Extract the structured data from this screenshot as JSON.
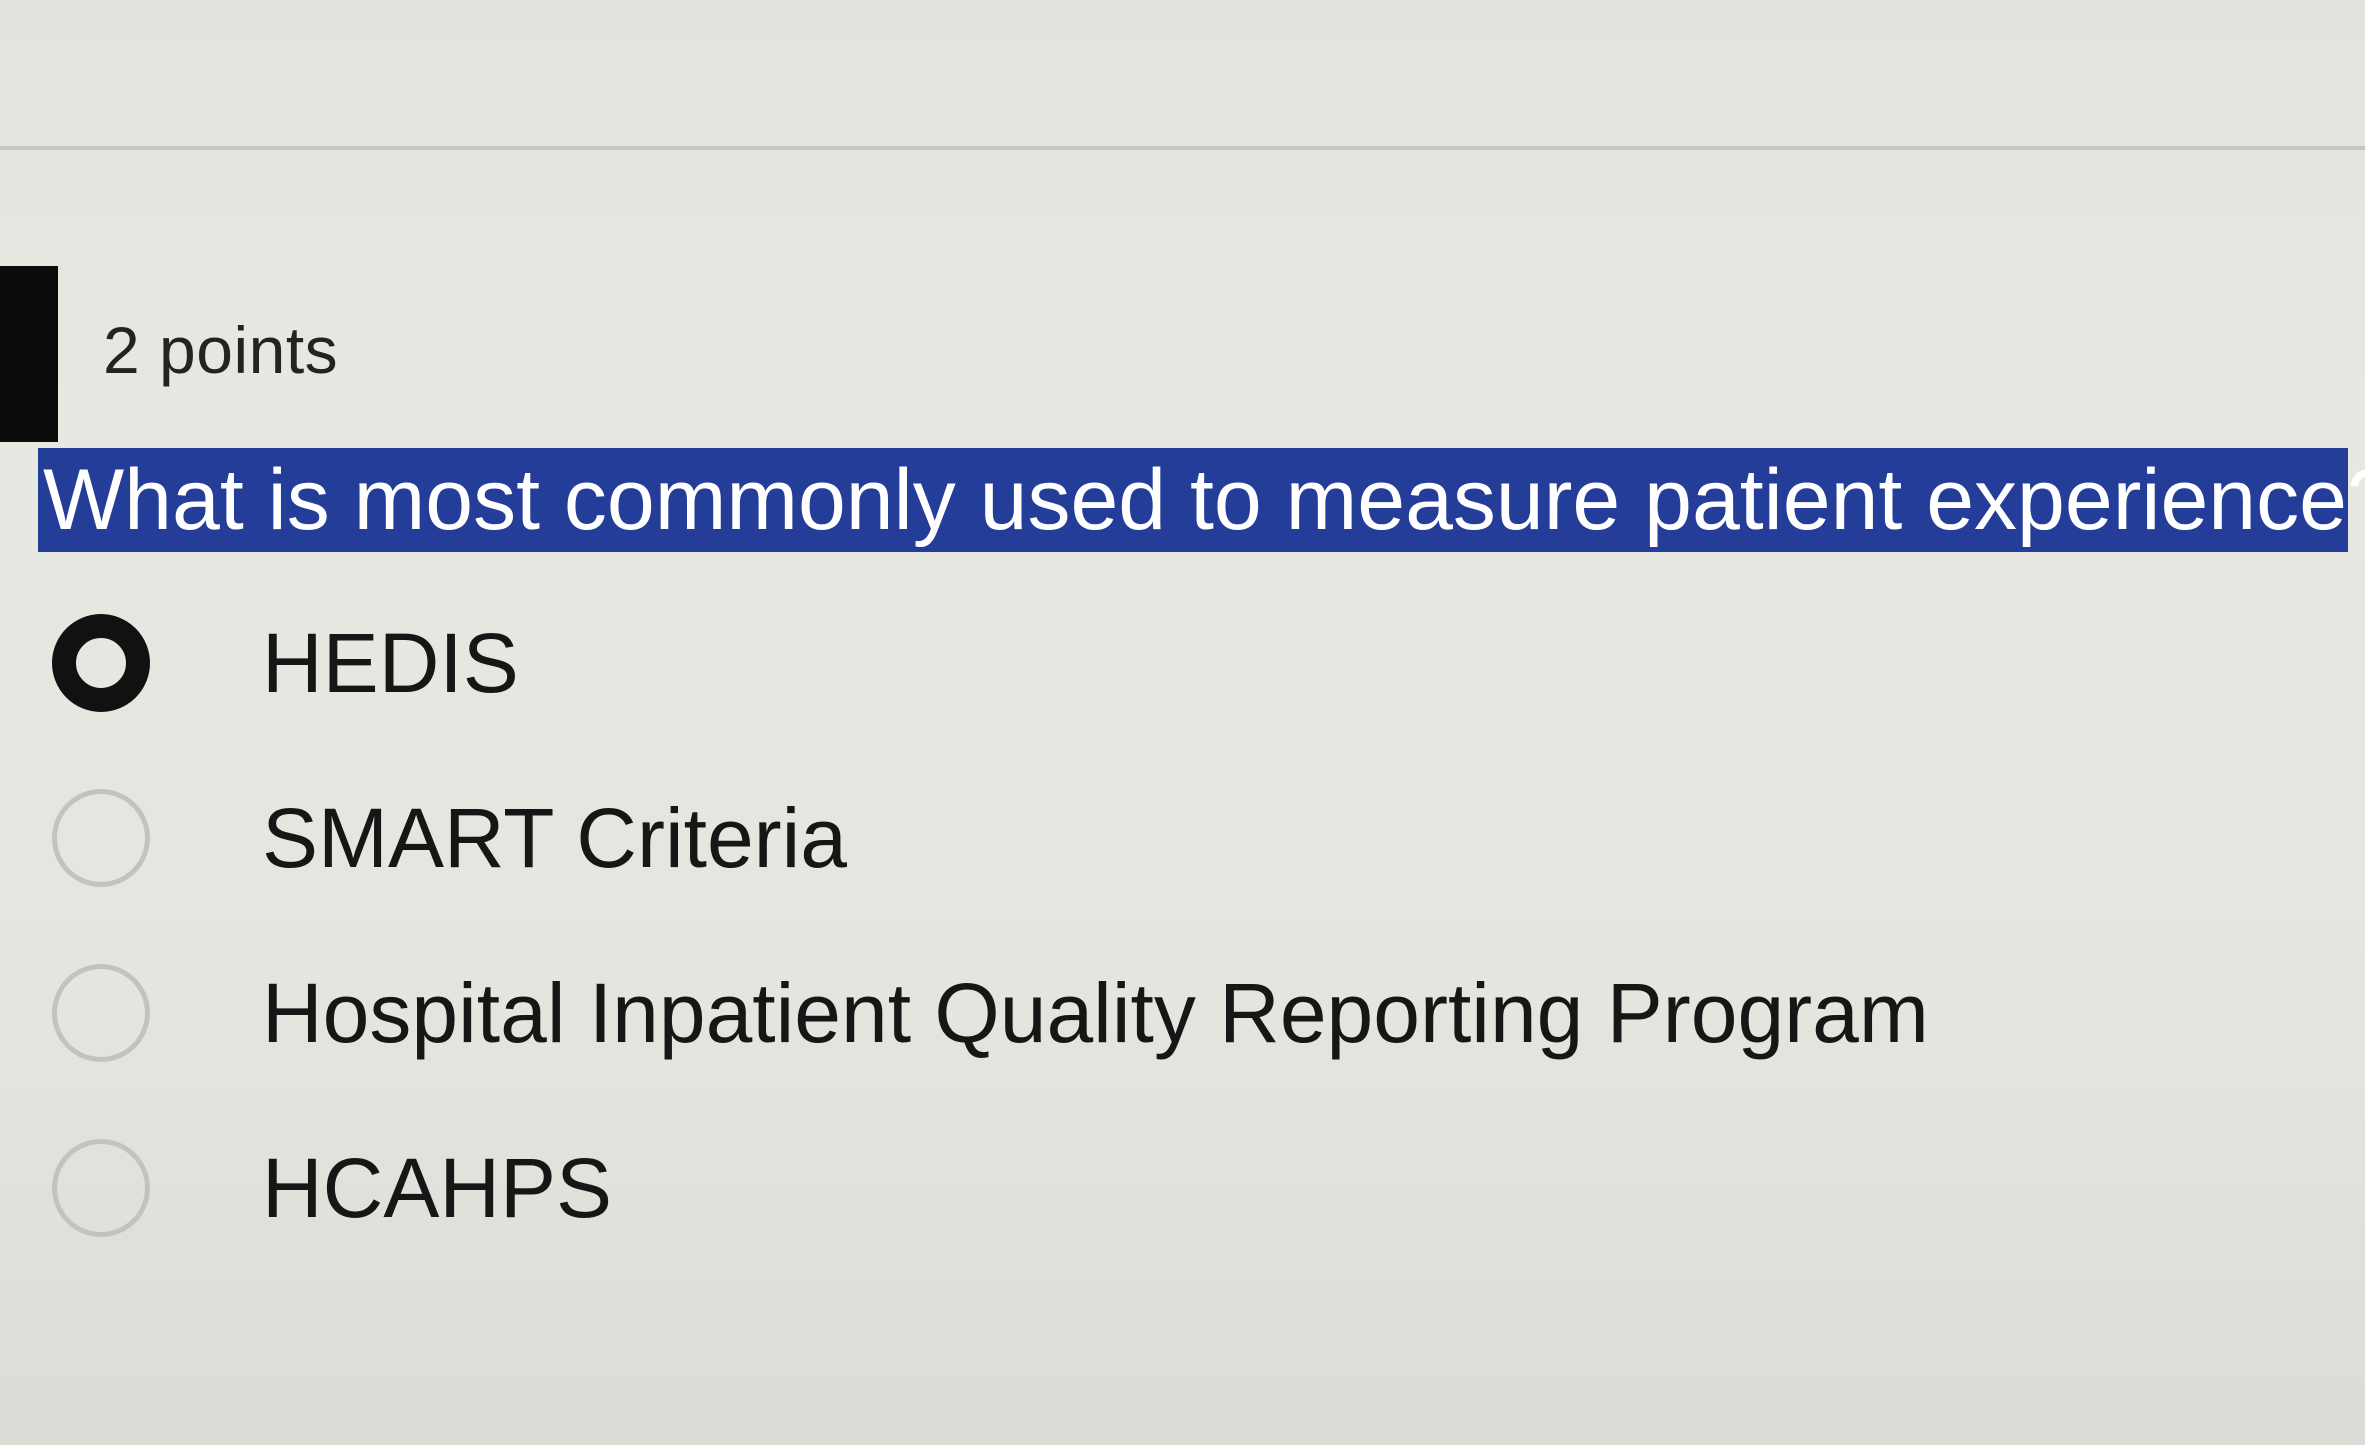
{
  "question": {
    "points_label": "2 points",
    "text": "What is most commonly used to measure patient experience?"
  },
  "options": [
    {
      "label": "HEDIS",
      "focused": true
    },
    {
      "label": "SMART Criteria",
      "focused": false
    },
    {
      "label": "Hospital Inpatient Quality Reporting Program",
      "focused": false
    },
    {
      "label": "HCAHPS",
      "focused": false
    }
  ],
  "colors": {
    "question_highlight": "#243d99",
    "question_text": "#ffffff",
    "background": "#e6e6e1",
    "marker": "#0b0b0b"
  }
}
